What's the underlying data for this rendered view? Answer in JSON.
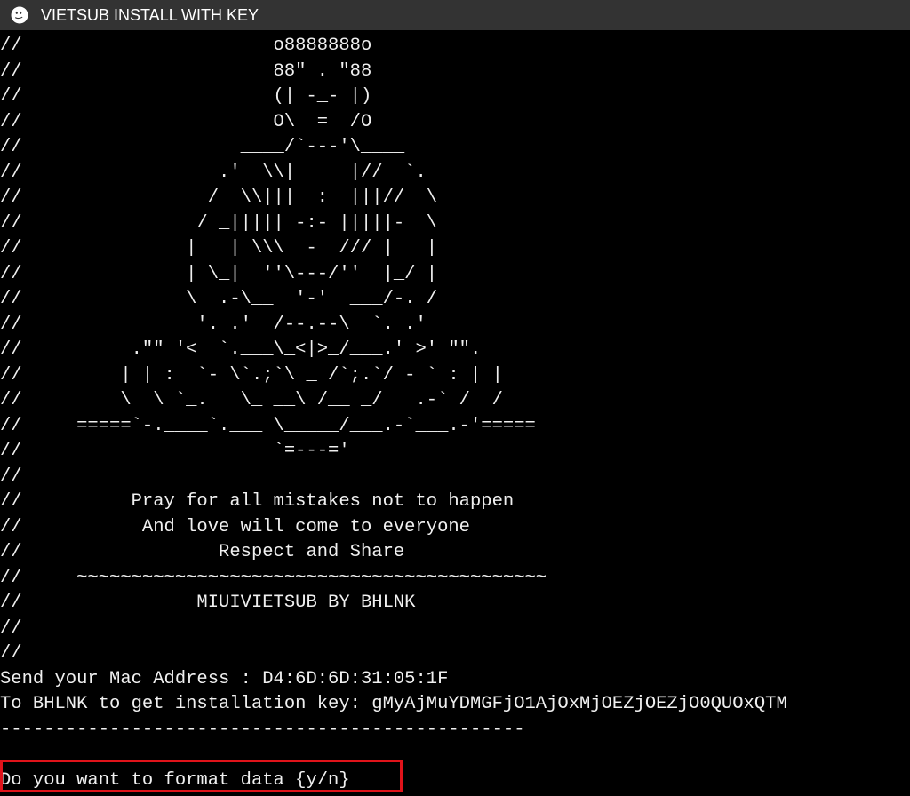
{
  "window": {
    "title": "VIETSUB INSTALL WITH KEY",
    "icon": "ghost-app-icon",
    "titlebar_color": "#333333",
    "background_color": "#000000",
    "text_color": "#f0f0f0",
    "highlight_color": "#e0131a"
  },
  "console": {
    "art_lines": [
      "//                       o8888888o",
      "//                       88\" . \"88",
      "//                       (| -_- |)",
      "//                       O\\  =  /O",
      "//                    ____/`---'\\____",
      "//                  .'  \\\\|     |//  `.",
      "//                 /  \\\\|||  :  |||//  \\",
      "//                / _||||| -:- |||||-  \\",
      "//               |   | \\\\\\  -  /// |   |",
      "//               | \\_|  ''\\---/''  |_/ |",
      "//               \\  .-\\__  '-'  ___/-. /",
      "//             ___'. .'  /--.--\\  `. .'___",
      "//          .\"\" '<  `.___\\_<|>_/___.' >' \"\".",
      "//         | | :  `- \\`.;`\\ _ /`;.`/ - ` : | |",
      "//         \\  \\ `_.   \\_ __\\ /__ _/   .-` /  /",
      "//     =====`-.____`.___ \\_____/___.-`___.-'=====",
      "//                       `=---='",
      "//",
      "//          Pray for all mistakes not to happen",
      "//           And love will come to everyone",
      "//                  Respect and Share",
      "//     ~~~~~~~~~~~~~~~~~~~~~~~~~~~~~~~~~~~~~~~~~~~",
      "//                MIUIVIETSUB BY BHLNK",
      "//",
      "//"
    ],
    "mac_line": "Send your Mac Address : D4:6D:6D:31:05:1F",
    "key_line": "To BHLNK to get installation key: gMyAjMuYDMGFjO1AjOxMjOEZjOEZjO0QUOxQTM",
    "separator_line": "------------------------------------------------",
    "blank_line": "",
    "prompt_line": "Do you want to format data {y/n}"
  }
}
